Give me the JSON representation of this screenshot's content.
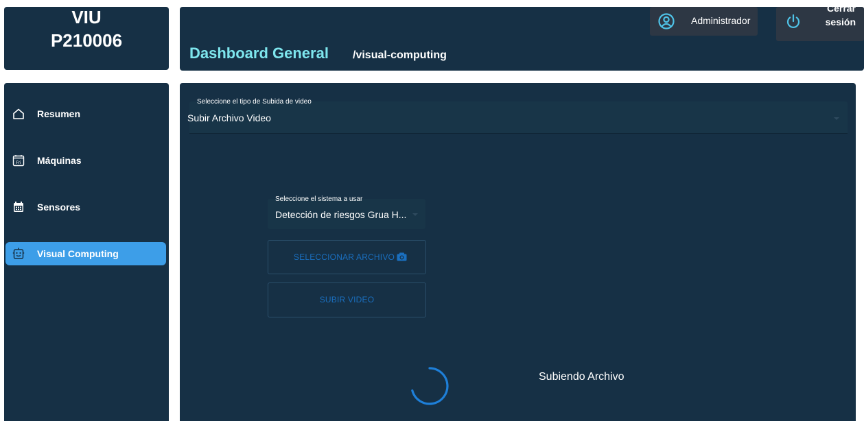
{
  "logo": {
    "line1": "VIU",
    "line2": "P210006"
  },
  "header": {
    "title": "Dashboard General",
    "route": "/visual-computing",
    "user_label": "Administrador",
    "logout_line1": "Cerrar",
    "logout_line2": "sesión"
  },
  "sidebar": {
    "items": [
      {
        "label": "Resumen",
        "icon": "home-icon"
      },
      {
        "label": "Máquinas",
        "icon": "calendar-fri-icon"
      },
      {
        "label": "Sensores",
        "icon": "calendar-grid-icon"
      },
      {
        "label": "Visual Computing",
        "icon": "robot-face-icon",
        "active": true
      }
    ]
  },
  "main": {
    "upload_type": {
      "label": "Seleccione el tipo de Subida de video",
      "value": "Subir Archivo Video"
    },
    "system": {
      "label": "Seleccione el sistema a usar",
      "value": "Detección de riesgos Grua H..."
    },
    "select_file_label": "SELECCIONAR ARCHIVO",
    "upload_label": "SUBIR VIDEO",
    "status_text": "Subiendo Archivo"
  },
  "colors": {
    "panel": "#163045",
    "accent_title": "#7ee6ee",
    "active_nav": "#3d9ee8",
    "icon_accent": "#4fc3e8",
    "button_text": "#1a6fbf",
    "spinner": "#1e7fd8"
  }
}
